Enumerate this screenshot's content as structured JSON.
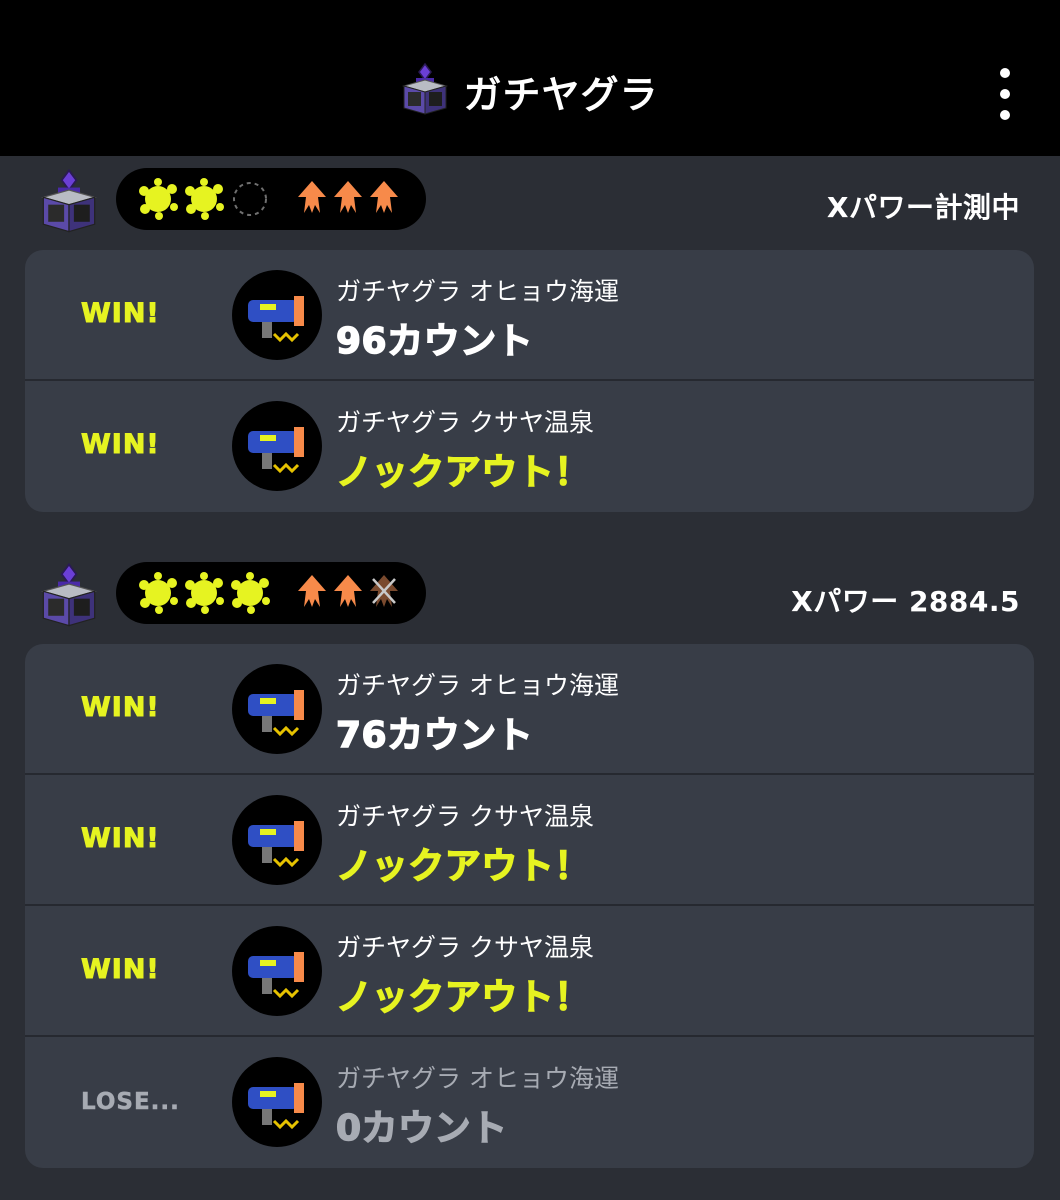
{
  "header": {
    "title": "ガチヤグラ",
    "icon": "tower-icon",
    "menu_icon": "more-vert-icon"
  },
  "colors": {
    "win": "#e6f321",
    "lose": "#a7abb3",
    "squid": "#f78a4a",
    "squid_lost": "#7a4a2e",
    "card": "#383d47",
    "bg": "#2b2e35"
  },
  "sets": [
    {
      "xpower": "Xパワー計測中",
      "wins_filled": 2,
      "wins_total": 3,
      "lives_remaining": 3,
      "lives_total": 3,
      "games": [
        {
          "result": "WIN!",
          "stage": "ガチヤグラ オヒョウ海運",
          "score": "96カウント",
          "score_kind": "count",
          "weapon": "weapon-icon"
        },
        {
          "result": "WIN!",
          "stage": "ガチヤグラ クサヤ温泉",
          "score": "ノックアウト！",
          "score_kind": "knockout",
          "weapon": "weapon-icon"
        }
      ]
    },
    {
      "xpower": "Xパワー 2884.5",
      "wins_filled": 3,
      "wins_total": 3,
      "lives_remaining": 2,
      "lives_total": 3,
      "games": [
        {
          "result": "WIN!",
          "stage": "ガチヤグラ オヒョウ海運",
          "score": "76カウント",
          "score_kind": "count",
          "weapon": "weapon-icon"
        },
        {
          "result": "WIN!",
          "stage": "ガチヤグラ クサヤ温泉",
          "score": "ノックアウト！",
          "score_kind": "knockout",
          "weapon": "weapon-icon"
        },
        {
          "result": "WIN!",
          "stage": "ガチヤグラ クサヤ温泉",
          "score": "ノックアウト！",
          "score_kind": "knockout",
          "weapon": "weapon-icon"
        },
        {
          "result": "LOSE...",
          "stage": "ガチヤグラ オヒョウ海運",
          "score": "0カウント",
          "score_kind": "lose",
          "weapon": "weapon-icon"
        }
      ]
    }
  ]
}
